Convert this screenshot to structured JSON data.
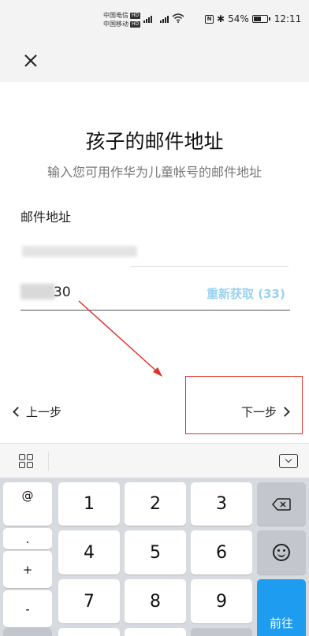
{
  "status_bar": {
    "carrier1": "中国电信",
    "carrier2": "中国移动",
    "hd": "HD",
    "network": "4G",
    "battery": "54%",
    "time": "12:11"
  },
  "page": {
    "title": "孩子的邮件地址",
    "subtitle": "输入您可用作华为儿童帐号的邮件地址",
    "email_label": "邮件地址",
    "code_visible": "30",
    "resend_label": "重新获取 (33)"
  },
  "nav": {
    "prev_label": "上一步",
    "next_label": "下一步"
  },
  "keyboard": {
    "symbols": [
      "@",
      ".",
      "+",
      "-"
    ],
    "row1": [
      "1",
      "2",
      "3"
    ],
    "row2": [
      "4",
      "5",
      "6"
    ],
    "row3": [
      "7",
      "8",
      "9"
    ],
    "go_label": "前往"
  },
  "colors": {
    "accent": "#1e9cf0",
    "resend_disabled": "#9ad2ee",
    "annotation": "#e0322b"
  }
}
